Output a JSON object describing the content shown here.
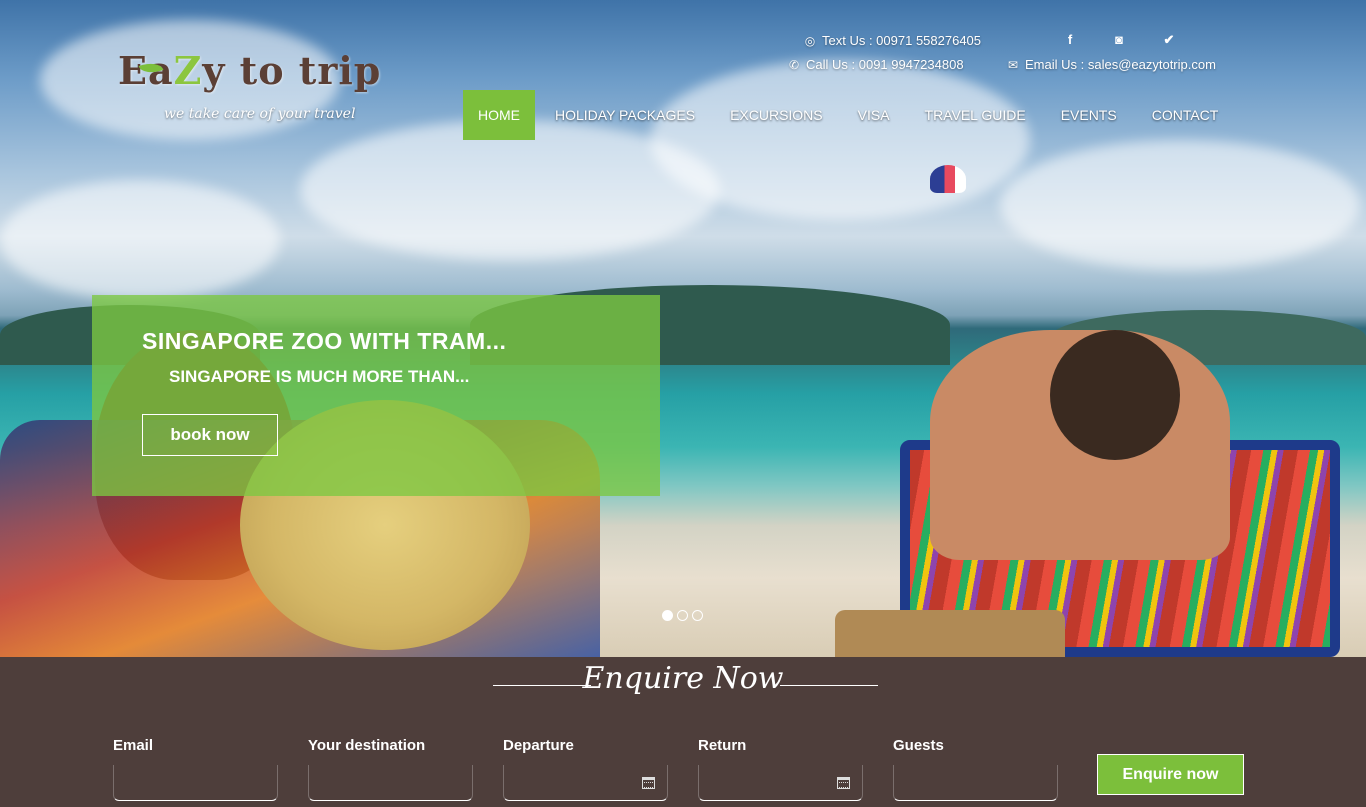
{
  "brand": {
    "logo_text_a": "Ea",
    "logo_text_z": "Z",
    "logo_text_b": "y to trip",
    "tagline": "we take care of your travel"
  },
  "contact": {
    "text_us": "Text Us : 00971 558276405",
    "call_us": "Call Us : 0091 9947234808",
    "email_us": "Email Us : sales@eazytotrip.com"
  },
  "social": {
    "facebook": "f",
    "instagram": "◙",
    "twitter": "✔"
  },
  "nav": {
    "items": [
      {
        "label": "HOME"
      },
      {
        "label": "HOLIDAY PACKAGES"
      },
      {
        "label": "EXCURSIONS"
      },
      {
        "label": "VISA"
      },
      {
        "label": "TRAVEL GUIDE"
      },
      {
        "label": "EVENTS"
      },
      {
        "label": "CONTACT"
      }
    ],
    "active": "HOME"
  },
  "slide": {
    "title": "SINGAPORE ZOO WITH TRAM...",
    "subtitle": "SINGAPORE IS MUCH MORE THAN...",
    "button": "book now",
    "slide_count": 3,
    "active_slide": 1
  },
  "enquiry": {
    "title": "Enquire Now",
    "fields": [
      {
        "label": "Email",
        "value": "",
        "calendar": false
      },
      {
        "label": "Your destination",
        "value": "",
        "calendar": false
      },
      {
        "label": "Departure",
        "value": "",
        "calendar": true
      },
      {
        "label": "Return",
        "value": "",
        "calendar": true
      },
      {
        "label": "Guests",
        "value": "",
        "calendar": false
      }
    ],
    "submit": "Enquire now"
  },
  "colors": {
    "accent_green": "#7cbf3b",
    "enquiry_bg": "#4e3e3b",
    "logo_brown": "#5b3f35"
  }
}
